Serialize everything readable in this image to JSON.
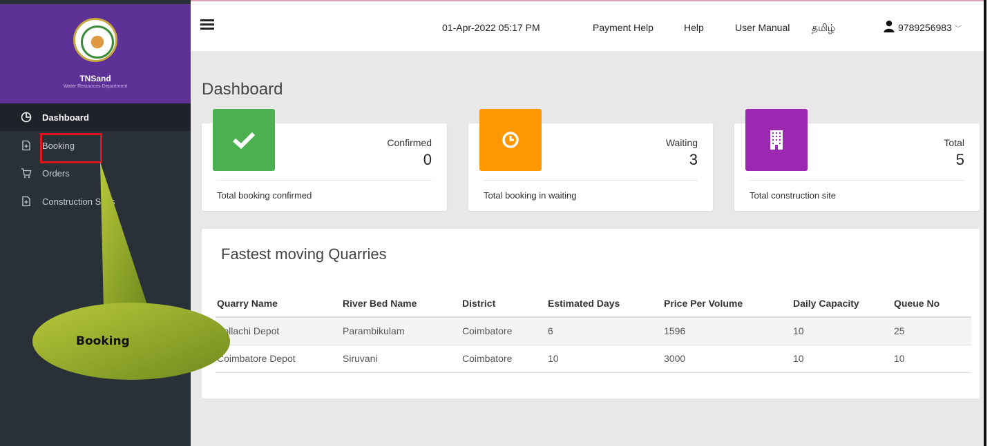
{
  "brand": {
    "name": "TNSand",
    "subtitle": "Water Resources Department"
  },
  "sidebar": {
    "items": [
      {
        "label": "Dashboard",
        "icon": "pie-chart-icon",
        "active": true
      },
      {
        "label": "Booking",
        "icon": "file-plus-icon"
      },
      {
        "label": "Orders",
        "icon": "cart-icon"
      },
      {
        "label": "Construction Sites",
        "icon": "file-plus-icon"
      }
    ]
  },
  "topbar": {
    "datetime": "01-Apr-2022 05:17 PM",
    "payment_help": "Payment Help",
    "help": "Help",
    "user_manual": "User Manual",
    "language": "தமிழ்",
    "user_phone": "9789256983",
    "user_caret": "﹀"
  },
  "page": {
    "title": "Dashboard"
  },
  "cards": [
    {
      "label": "Confirmed",
      "value": "0",
      "footer": "Total booking confirmed",
      "color": "#4caf50",
      "icon": "check-icon"
    },
    {
      "label": "Waiting",
      "value": "3",
      "footer": "Total booking in waiting",
      "color": "#ff9800",
      "icon": "clock-icon"
    },
    {
      "label": "Total",
      "value": "5",
      "footer": "Total construction site",
      "color": "#9c27b0",
      "icon": "building-icon"
    }
  ],
  "quarries": {
    "title": "Fastest moving Quarries",
    "headers": [
      "Quarry Name",
      "River Bed Name",
      "District",
      "Estimated Days",
      "Price Per Volume",
      "Daily Capacity",
      "Queue No"
    ],
    "rows": [
      [
        "Pollachi Depot",
        "Parambikulam",
        "Coimbatore",
        "6",
        "1596",
        "10",
        "25"
      ],
      [
        "Coimbatore Depot",
        "Siruvani",
        "Coimbatore",
        "10",
        "3000",
        "10",
        "10"
      ]
    ]
  },
  "annotation": {
    "callout_label": "Booking"
  }
}
